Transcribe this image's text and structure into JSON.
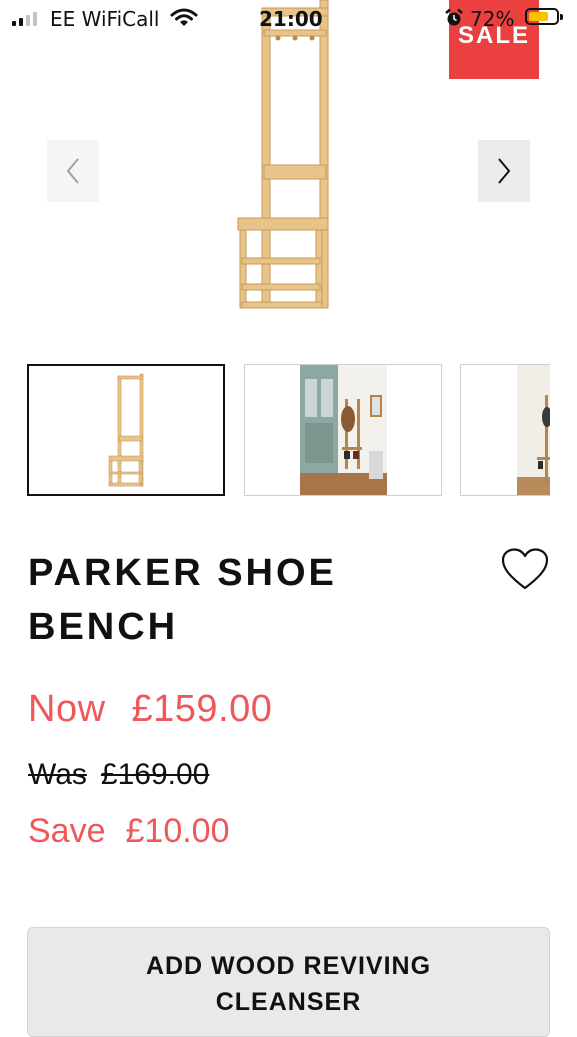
{
  "status_bar": {
    "carrier": "EE WiFiCall",
    "time": "21:00",
    "battery_percent": "72%",
    "battery_level": 0.72,
    "battery_color": "#f5c400"
  },
  "gallery": {
    "sale_badge": "SALE",
    "sale_color": "#ea4140",
    "prev_icon": "chevron-left-icon",
    "next_icon": "chevron-right-icon",
    "thumbnails": [
      {
        "name": "thumb-shoe-bench-front",
        "selected": true
      },
      {
        "name": "thumb-shoe-bench-hallway",
        "selected": false
      },
      {
        "name": "thumb-shoe-bench-room",
        "selected": false
      }
    ]
  },
  "product": {
    "title": "PARKER SHOE BENCH",
    "wishlist_icon": "heart-icon",
    "price_now_label": "Now",
    "price_now": "£159.00",
    "price_was_label": "Was",
    "price_was": "£169.00",
    "save_label": "Save",
    "save_amount": "£10.00",
    "accent_color": "#f0575a"
  },
  "addon_button": {
    "label": "ADD WOOD REVIVING CLEANSER"
  }
}
